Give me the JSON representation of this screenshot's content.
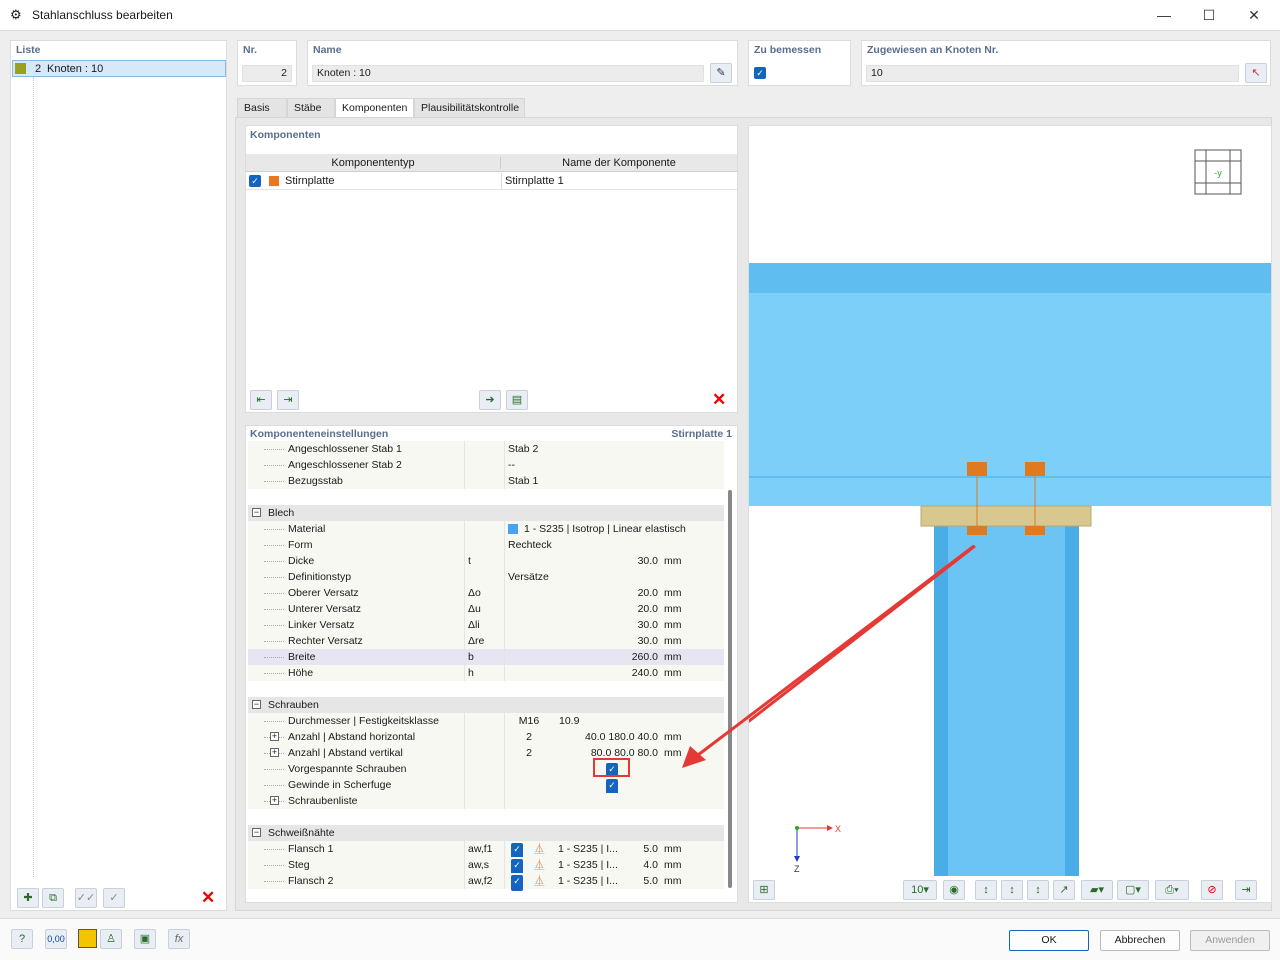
{
  "window": {
    "title": "Stahlanschluss bearbeiten",
    "minimize": "—",
    "maximize": "☐",
    "close": "✕"
  },
  "list": {
    "label": "Liste",
    "items": [
      {
        "num": "2",
        "text": "Knoten : 10",
        "color": "#9aa020"
      }
    ]
  },
  "header": {
    "nr": {
      "label": "Nr.",
      "value": "2"
    },
    "name": {
      "label": "Name",
      "value": "Knoten : 10"
    },
    "design": {
      "label": "Zu bemessen",
      "checked": true
    },
    "assigned": {
      "label": "Zugewiesen an Knoten Nr.",
      "value": "10"
    }
  },
  "tabs": [
    {
      "label": "Basis"
    },
    {
      "label": "Stäbe"
    },
    {
      "label": "Komponenten",
      "active": true
    },
    {
      "label": "Plausibilitätskontrolle"
    }
  ],
  "components": {
    "title": "Komponenten",
    "columns": [
      "Komponententyp",
      "Name der Komponente"
    ],
    "rows": [
      {
        "checked": true,
        "color": "#e87722",
        "type": "Stirnplatte",
        "name": "Stirnplatte 1"
      }
    ]
  },
  "settings": {
    "title": "Komponenteneinstellungen",
    "component": "Stirnplatte 1",
    "rows": [
      {
        "k": "item",
        "name": "Angeschlossener Stab 1",
        "val": "Stab 2"
      },
      {
        "k": "item",
        "name": "Angeschlossener Stab 2",
        "val": "--"
      },
      {
        "k": "item",
        "name": "Bezugsstab",
        "val": "Stab 1"
      },
      {
        "k": "blank"
      },
      {
        "k": "group",
        "name": "Blech"
      },
      {
        "k": "item",
        "name": "Material",
        "val": "1 - S235 | Isotrop | Linear elastisch",
        "swatch": "#4aa3f0"
      },
      {
        "k": "item",
        "name": "Form",
        "val": "Rechteck"
      },
      {
        "k": "item",
        "name": "Dicke",
        "sym": "t",
        "num": "30.0",
        "unit": "mm"
      },
      {
        "k": "item",
        "name": "Definitionstyp",
        "val": "Versätze"
      },
      {
        "k": "item",
        "name": "Oberer Versatz",
        "sym": "Δo",
        "num": "20.0",
        "unit": "mm"
      },
      {
        "k": "item",
        "name": "Unterer Versatz",
        "sym": "Δu",
        "num": "20.0",
        "unit": "mm"
      },
      {
        "k": "item",
        "name": "Linker Versatz",
        "sym": "Δli",
        "num": "30.0",
        "unit": "mm"
      },
      {
        "k": "item",
        "name": "Rechter Versatz",
        "sym": "Δre",
        "num": "30.0",
        "unit": "mm"
      },
      {
        "k": "item",
        "name": "Breite",
        "sym": "b",
        "num": "260.0",
        "unit": "mm",
        "selected": true
      },
      {
        "k": "item",
        "name": "Höhe",
        "sym": "h",
        "num": "240.0",
        "unit": "mm"
      },
      {
        "k": "blank"
      },
      {
        "k": "group",
        "name": "Schrauben"
      },
      {
        "k": "item",
        "name": "Durchmesser | Festigkeitsklasse",
        "mid": "M16",
        "val2": "10.9"
      },
      {
        "k": "item",
        "name": "Anzahl | Abstand horizontal",
        "expand": true,
        "mid": "2",
        "num": "40.0 180.0 40.0",
        "unit": "mm"
      },
      {
        "k": "item",
        "name": "Anzahl | Abstand vertikal",
        "expand": true,
        "mid": "2",
        "num": "80.0 80.0 80.0",
        "unit": "mm"
      },
      {
        "k": "item",
        "name": "Vorgespannte Schrauben",
        "check": true,
        "highlight": true
      },
      {
        "k": "item",
        "name": "Gewinde in Scherfuge",
        "check": true
      },
      {
        "k": "item",
        "name": "Schraubenliste",
        "expand": true
      },
      {
        "k": "blank"
      },
      {
        "k": "group",
        "name": "Schweißnähte"
      },
      {
        "k": "item",
        "name": "Flansch 1",
        "sym": "aw,f1",
        "weld": true,
        "mat": "1 - S235 | I...",
        "num": "5.0",
        "unit": "mm"
      },
      {
        "k": "item",
        "name": "Steg",
        "sym": "aw,s",
        "weld": true,
        "mat": "1 - S235 | I...",
        "num": "4.0",
        "unit": "mm"
      },
      {
        "k": "item",
        "name": "Flansch 2",
        "sym": "aw,f2",
        "weld": true,
        "mat": "1 - S235 | I...",
        "num": "5.0",
        "unit": "mm"
      }
    ]
  },
  "view": {
    "axis_x": "X",
    "axis_z": "Z",
    "cube_label": "-y",
    "zoom_label": "10",
    "beam_color": "#7ccff8",
    "plate_color": "#d8c890",
    "bolt_color": "#e07a20",
    "highlight_color": "#e53935"
  },
  "buttons": {
    "ok": "OK",
    "cancel": "Abbrechen",
    "apply": "Anwenden"
  },
  "status": {
    "units": "0,00"
  }
}
